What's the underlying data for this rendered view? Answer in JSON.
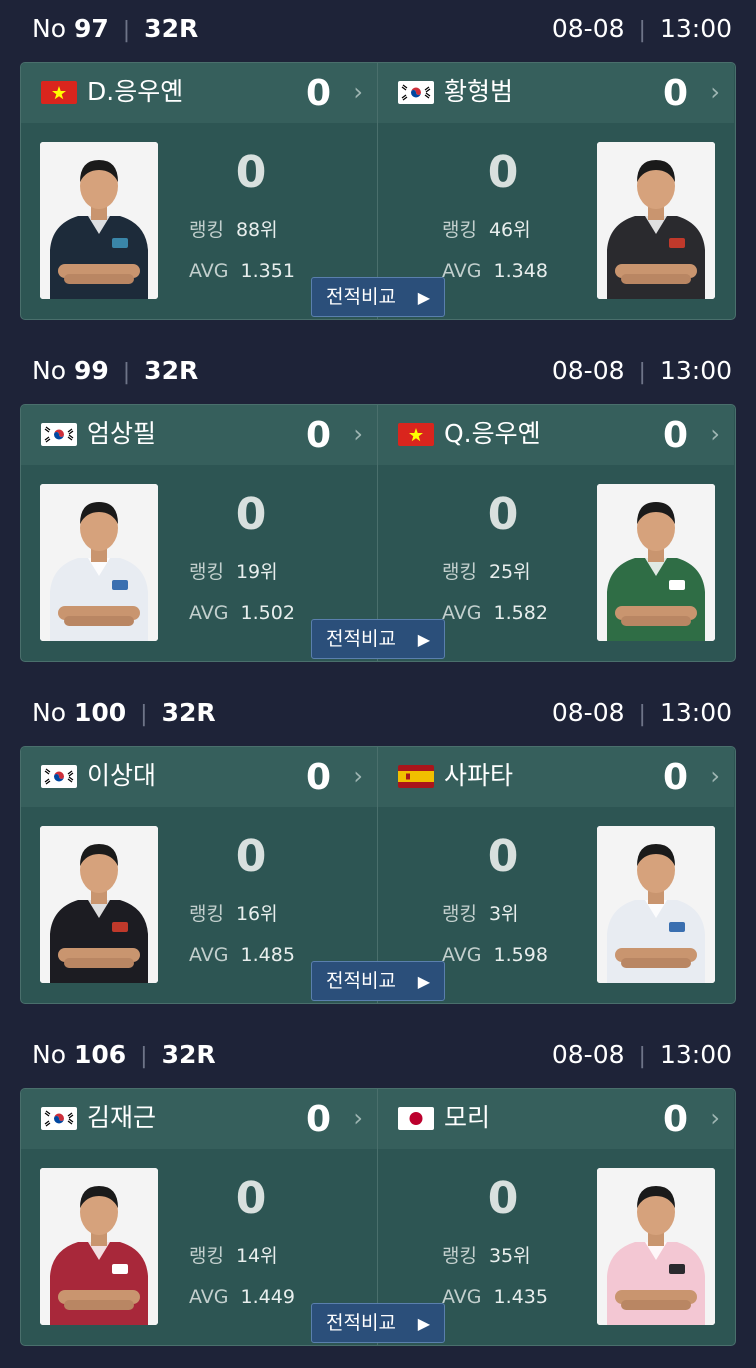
{
  "compare_label": "전적비교",
  "matches": [
    {
      "no_label": "No",
      "no": "97",
      "round": "32R",
      "date": "08-08",
      "time": "13:00",
      "left": {
        "flag": "vn",
        "name": "D.응우옌",
        "score": "0",
        "big_score": "0",
        "rank_label": "랭킹",
        "rank": "88위",
        "avg_label": "AVG",
        "avg": "1.351",
        "shirt": "#1d2b3a",
        "accent": "#3a86a8"
      },
      "right": {
        "flag": "kr",
        "name": "황형범",
        "score": "0",
        "big_score": "0",
        "rank_label": "랭킹",
        "rank": "46위",
        "avg_label": "AVG",
        "avg": "1.348",
        "shirt": "#2a2a2e",
        "accent": "#c0392b"
      }
    },
    {
      "no_label": "No",
      "no": "99",
      "round": "32R",
      "date": "08-08",
      "time": "13:00",
      "left": {
        "flag": "kr",
        "name": "엄상필",
        "score": "0",
        "big_score": "0",
        "rank_label": "랭킹",
        "rank": "19위",
        "avg_label": "AVG",
        "avg": "1.502",
        "shirt": "#e8ecf2",
        "accent": "#3a6fb0"
      },
      "right": {
        "flag": "vn",
        "name": "Q.응우옌",
        "score": "0",
        "big_score": "0",
        "rank_label": "랭킹",
        "rank": "25위",
        "avg_label": "AVG",
        "avg": "1.582",
        "shirt": "#2f6d45",
        "accent": "#ffffff"
      }
    },
    {
      "no_label": "No",
      "no": "100",
      "round": "32R",
      "date": "08-08",
      "time": "13:00",
      "left": {
        "flag": "kr",
        "name": "이상대",
        "score": "0",
        "big_score": "0",
        "rank_label": "랭킹",
        "rank": "16위",
        "avg_label": "AVG",
        "avg": "1.485",
        "shirt": "#1c1c22",
        "accent": "#c0392b"
      },
      "right": {
        "flag": "es",
        "name": "사파타",
        "score": "0",
        "big_score": "0",
        "rank_label": "랭킹",
        "rank": "3위",
        "avg_label": "AVG",
        "avg": "1.598",
        "shirt": "#e8ecf2",
        "accent": "#3a6fb0"
      }
    },
    {
      "no_label": "No",
      "no": "106",
      "round": "32R",
      "date": "08-08",
      "time": "13:00",
      "left": {
        "flag": "kr",
        "name": "김재근",
        "score": "0",
        "big_score": "0",
        "rank_label": "랭킹",
        "rank": "14위",
        "avg_label": "AVG",
        "avg": "1.449",
        "shirt": "#a8283a",
        "accent": "#ffffff"
      },
      "right": {
        "flag": "jp",
        "name": "모리",
        "score": "0",
        "big_score": "0",
        "rank_label": "랭킹",
        "rank": "35위",
        "avg_label": "AVG",
        "avg": "1.435",
        "shirt": "#f3c7d3",
        "accent": "#2a2a2e"
      }
    }
  ]
}
